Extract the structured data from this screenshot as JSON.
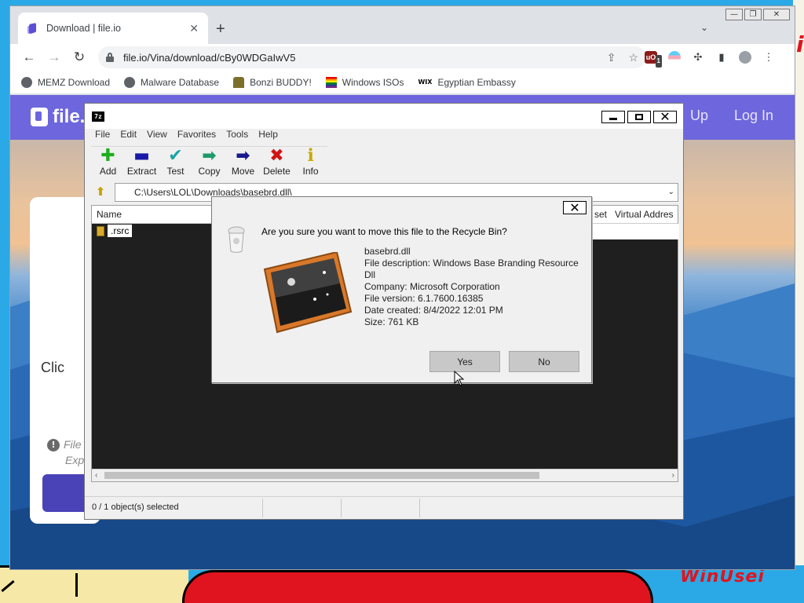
{
  "chrome": {
    "tab_title": "Download | file.io",
    "tab_close": "✕",
    "new_tab": "+",
    "tab_search": "⌄",
    "controls": {
      "minimize": "—",
      "restore": "❐",
      "close": "✕"
    },
    "nav": {
      "back": "←",
      "forward": "→",
      "reload": "↻"
    },
    "url": "file.io/Vina/download/cBy0WDGaIwV5",
    "omnibox_icons": {
      "share": "⇪",
      "star": "☆"
    },
    "extensions": {
      "ublock_badge": "1",
      "ublock": "uO",
      "puzzle": "✣",
      "sidepanel": "▮",
      "menu": "⋮"
    },
    "bookmarks": [
      {
        "label": "MEMZ Download",
        "icon": "globe-icon"
      },
      {
        "label": "Malware Database",
        "icon": "globe-icon"
      },
      {
        "label": "Bonzi BUDDY!",
        "icon": "bonzi-icon"
      },
      {
        "label": "Windows ISOs",
        "icon": "rainbow-flag-icon"
      },
      {
        "label": "Egyptian Embassy",
        "icon": "wix-icon",
        "icon_text": "WIX"
      }
    ]
  },
  "site": {
    "logo": "file.",
    "nav_signup": "Up",
    "nav_login": "Log In",
    "card_text": "Clic",
    "file_note_1": "File",
    "file_note_2": "Exp",
    "info_icon": "!",
    "colors": {
      "header": "#6d66dd",
      "button": "#4a43b8"
    }
  },
  "sevenzip": {
    "app_icon": "7z",
    "menu": [
      "File",
      "Edit",
      "View",
      "Favorites",
      "Tools",
      "Help"
    ],
    "tools": [
      {
        "label": "Add",
        "glyph": "✚",
        "color": "#1fae1f"
      },
      {
        "label": "Extract",
        "glyph": "▬",
        "color": "#1a1aa8"
      },
      {
        "label": "Test",
        "glyph": "✔",
        "color": "#19a3a3"
      },
      {
        "label": "Copy",
        "glyph": "➡",
        "color": "#1f9a6a"
      },
      {
        "label": "Move",
        "glyph": "➡",
        "color": "#1a1a8c"
      },
      {
        "label": "Delete",
        "glyph": "✖",
        "color": "#d01515"
      },
      {
        "label": "Info",
        "glyph": "ℹ",
        "color": "#c8a800"
      }
    ],
    "path": "C:\\Users\\LOL\\Downloads\\basebrd.dll\\",
    "up_icon": "⬆",
    "columns": {
      "name": "Name",
      "offset": "set",
      "virtual": "Virtual Addres"
    },
    "rows": [
      {
        "name": ".rsrc"
      }
    ],
    "status": "0 / 1 object(s) selected",
    "win": {
      "minimize": "▁",
      "maximize": "□",
      "close": "✕"
    }
  },
  "dialog": {
    "question": "Are you sure you want to move this file to the Recycle Bin?",
    "filename": "basebrd.dll",
    "description": "File description: Windows Base Branding Resource Dll",
    "company": "Company: Microsoft Corporation",
    "version": "File version: 6.1.7600.16385",
    "created": "Date created: 8/4/2022 12:01 PM",
    "size": "Size: 761 KB",
    "yes": "Yes",
    "no": "No",
    "close": "✕"
  },
  "desktop": {
    "scribble": "i",
    "bottom_text": "WinUsei"
  }
}
